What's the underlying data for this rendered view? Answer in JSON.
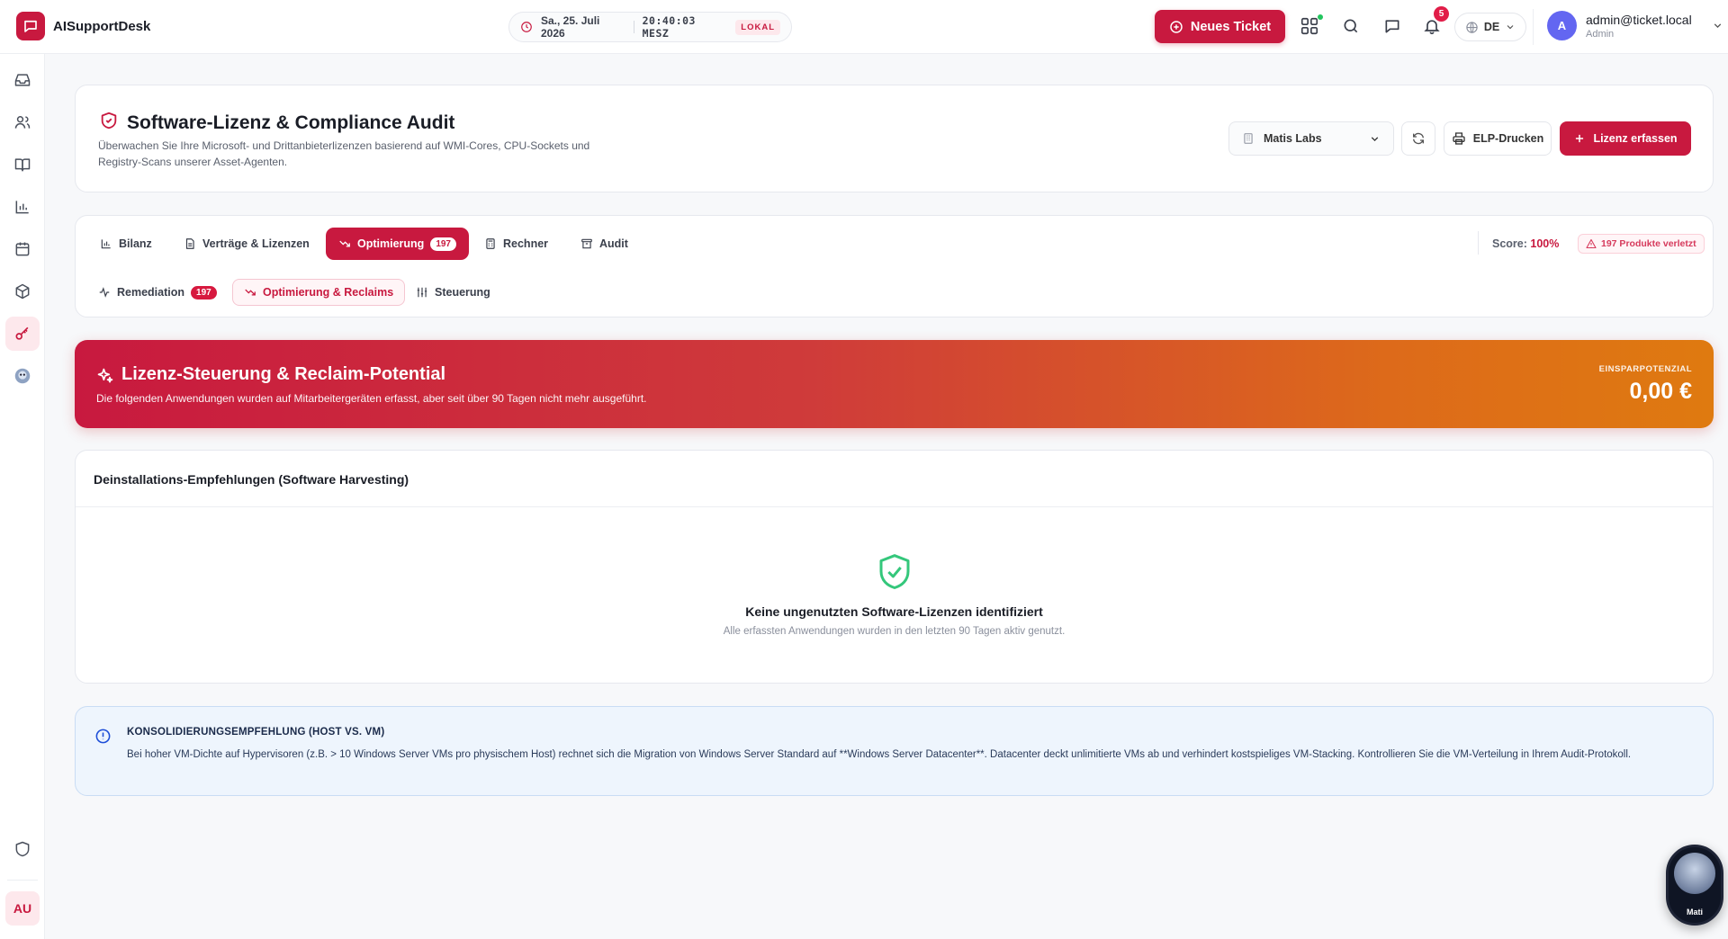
{
  "app": {
    "name": "AISupportDesk"
  },
  "clock": {
    "date": "Sa., 25. Juli 2026",
    "time": "20:40:03 MESZ",
    "mode": "LOKAL"
  },
  "topbar": {
    "new_ticket": "Neues Ticket",
    "notifications_count": "5",
    "language": "DE",
    "user_email": "admin@ticket.local",
    "user_role": "Admin",
    "avatar_initial": "A"
  },
  "sidebar": {
    "items": [
      "inbox-icon",
      "users-icon",
      "book-icon",
      "chart-icon",
      "calendar-icon",
      "box-icon",
      "key-icon",
      "bot-icon"
    ],
    "active": "key-icon",
    "footer_initials": "AU"
  },
  "header": {
    "title": "Software-Lizenz & Compliance Audit",
    "subtitle": "Überwachen Sie Ihre Microsoft- und Drittanbieterlizenzen basierend auf WMI-Cores, CPU-Sockets und Registry-Scans unserer Asset-Agenten.",
    "org": "Matis Labs",
    "print_label": "ELP-Drucken",
    "add_label": "Lizenz erfassen"
  },
  "tabs": [
    {
      "label": "Bilanz",
      "icon": "bar-chart-icon"
    },
    {
      "label": "Verträge & Lizenzen",
      "icon": "file-icon"
    },
    {
      "label": "Optimierung",
      "icon": "trending-down-icon",
      "badge": "197",
      "active": true
    },
    {
      "label": "Rechner",
      "icon": "calculator-icon"
    },
    {
      "label": "Audit",
      "icon": "archive-icon"
    }
  ],
  "score": {
    "label": "Score:",
    "value": "100%"
  },
  "violation": "197 Produkte verletzt",
  "subtabs": [
    {
      "label": "Remediation",
      "icon": "activity-icon",
      "badge": "197"
    },
    {
      "label": "Optimierung & Reclaims",
      "icon": "trending-down-icon",
      "active": true
    },
    {
      "label": "Steuerung",
      "icon": "sliders-icon"
    }
  ],
  "banner": {
    "title": "Lizenz-Steuerung & Reclaim-Potential",
    "subtitle": "Die folgenden Anwendungen wurden auf Mitarbeitergeräten erfasst, aber seit über 90 Tagen nicht mehr ausgeführt.",
    "savings_label": "EINSPARPOTENZIAL",
    "savings_value": "0,00 €",
    "gradient": [
      "#c8193f",
      "#df7a10"
    ]
  },
  "recommendations": {
    "title": "Deinstallations-Empfehlungen (Software Harvesting)",
    "empty_title": "Keine ungenutzten Software-Lizenzen identifiziert",
    "empty_subtitle": "Alle erfassten Anwendungen wurden in den letzten 90 Tagen aktiv genutzt."
  },
  "info": {
    "title": "KONSOLIDIERUNGSEMPFEHLUNG (HOST VS. VM)",
    "text": "Bei hoher VM-Dichte auf Hypervisoren (z.B. > 10 Windows Server VMs pro physischem Host) rechnet sich die Migration von Windows Server Standard auf **Windows Server Datacenter**. Datacenter deckt unlimitierte VMs ab und verhindert kostspieliges VM-Stacking. Kontrollieren Sie die VM-Verteilung in Ihrem Audit-Protokoll."
  },
  "mascot": {
    "label": "Mati"
  },
  "colors": {
    "accent": "#c8193f",
    "success": "#34c77b",
    "info": "#1d4ed8"
  }
}
